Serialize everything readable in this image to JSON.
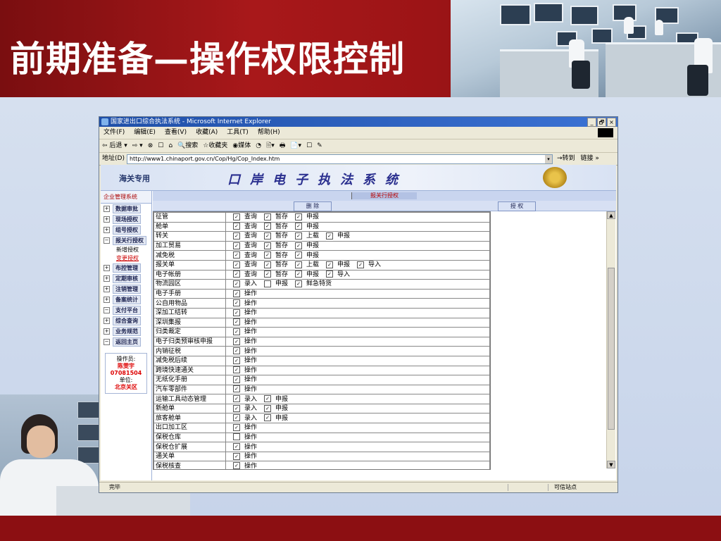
{
  "slide": {
    "title": "前期准备—操作权限控制"
  },
  "window": {
    "title": "国家进出口综合执法系统 - Microsoft Internet Explorer",
    "controls": [
      "_",
      "🗗",
      "×"
    ],
    "menu": [
      "文件(F)",
      "编辑(E)",
      "查看(V)",
      "收藏(A)",
      "工具(T)",
      "帮助(H)"
    ],
    "toolbar": [
      "⇦ 后退 ▾",
      "⇨ ▾",
      "⊗",
      "☐",
      "⌂",
      "🔍搜索",
      "☆收藏夹",
      "◉媒体",
      "◔",
      "🖹▾",
      "🖶",
      "📄▾",
      "☐",
      "✎"
    ],
    "address_label": "地址(D)",
    "address": "http://www1.chinaport.gov.cn/Cop/Hg/Cop_Index.htm",
    "go": "→转到",
    "links": "链接 »",
    "status_left": "完毕",
    "status_right": "可信站点"
  },
  "banner": {
    "tag": "海关专用",
    "system": "口岸电子执法系统"
  },
  "nav": {
    "header": "企业管理系统",
    "items": [
      {
        "pm": "+",
        "label": "数据审批"
      },
      {
        "pm": "+",
        "label": "现场授权"
      },
      {
        "pm": "+",
        "label": "组号授权"
      },
      {
        "pm": "−",
        "label": "报关行授权"
      },
      {
        "pm": "+",
        "label": "布控管理"
      },
      {
        "pm": "+",
        "label": "定期审核"
      },
      {
        "pm": "+",
        "label": "注销管理"
      },
      {
        "pm": "+",
        "label": "备案统计"
      },
      {
        "pm": "−",
        "label": "支付平台"
      },
      {
        "pm": "+",
        "label": "综合查询"
      },
      {
        "pm": "+",
        "label": "业务规范"
      },
      {
        "pm": "−",
        "label": "返回主页"
      }
    ],
    "subitems": [
      "新增授权",
      "变更授权"
    ],
    "user": {
      "label_op": "操作员:",
      "op": "陈雯宇",
      "id": "07081504",
      "label_unit": "单位:",
      "unit": "北京关区"
    }
  },
  "main": {
    "crumb": "报关行授权",
    "delete_btn": "删 除",
    "grant_btn": "授 权",
    "rows": [
      {
        "name": "征管",
        "opts": [
          {
            "c": true,
            "t": "查询"
          },
          {
            "c": true,
            "t": "暂存"
          },
          {
            "c": true,
            "t": "申报"
          }
        ]
      },
      {
        "name": "舱单",
        "opts": [
          {
            "c": true,
            "t": "查询"
          },
          {
            "c": true,
            "t": "暂存"
          },
          {
            "c": true,
            "t": "申报"
          }
        ]
      },
      {
        "name": "转关",
        "opts": [
          {
            "c": true,
            "t": "查询"
          },
          {
            "c": true,
            "t": "暂存"
          },
          {
            "c": true,
            "t": "上载"
          },
          {
            "c": true,
            "t": "申报"
          }
        ]
      },
      {
        "name": "加工贸易",
        "opts": [
          {
            "c": true,
            "t": "查询"
          },
          {
            "c": true,
            "t": "暂存"
          },
          {
            "c": true,
            "t": "申报"
          }
        ]
      },
      {
        "name": "减免税",
        "opts": [
          {
            "c": true,
            "t": "查询"
          },
          {
            "c": true,
            "t": "暂存"
          },
          {
            "c": true,
            "t": "申报"
          }
        ]
      },
      {
        "name": "报关单",
        "opts": [
          {
            "c": true,
            "t": "查询"
          },
          {
            "c": true,
            "t": "暂存"
          },
          {
            "c": true,
            "t": "上载"
          },
          {
            "c": true,
            "t": "申报"
          },
          {
            "c": true,
            "t": "导入"
          }
        ]
      },
      {
        "name": "电子帐册",
        "opts": [
          {
            "c": true,
            "t": "查询"
          },
          {
            "c": true,
            "t": "暂存"
          },
          {
            "c": true,
            "t": "申报"
          },
          {
            "c": true,
            "t": "导入"
          }
        ]
      },
      {
        "name": "物流园区",
        "opts": [
          {
            "c": true,
            "t": "录入"
          },
          {
            "c": false,
            "t": "申报"
          },
          {
            "c": true,
            "t": "鲜急特货"
          }
        ]
      },
      {
        "name": "电子手册",
        "opts": [
          {
            "c": true,
            "t": "操作"
          }
        ]
      },
      {
        "name": "公自用物品",
        "opts": [
          {
            "c": true,
            "t": "操作"
          }
        ]
      },
      {
        "name": "深加工结转",
        "opts": [
          {
            "c": true,
            "t": "操作"
          }
        ]
      },
      {
        "name": "深圳集报",
        "opts": [
          {
            "c": true,
            "t": "操作"
          }
        ]
      },
      {
        "name": "归类裁定",
        "opts": [
          {
            "c": true,
            "t": "操作"
          }
        ]
      },
      {
        "name": "电子归类预审核申报",
        "opts": [
          {
            "c": true,
            "t": "操作"
          }
        ]
      },
      {
        "name": "内销征税",
        "opts": [
          {
            "c": true,
            "t": "操作"
          }
        ]
      },
      {
        "name": "减免税后续",
        "opts": [
          {
            "c": true,
            "t": "操作"
          }
        ]
      },
      {
        "name": "跨境快速通关",
        "opts": [
          {
            "c": true,
            "t": "操作"
          }
        ]
      },
      {
        "name": "无纸化手册",
        "opts": [
          {
            "c": true,
            "t": "操作"
          }
        ]
      },
      {
        "name": "汽车零部件",
        "opts": [
          {
            "c": true,
            "t": "操作"
          }
        ]
      },
      {
        "name": "运输工具动态管理",
        "opts": [
          {
            "c": true,
            "t": "录入"
          },
          {
            "c": true,
            "t": "申报"
          }
        ]
      },
      {
        "name": "新舱单",
        "opts": [
          {
            "c": true,
            "t": "录入"
          },
          {
            "c": true,
            "t": "申报"
          }
        ]
      },
      {
        "name": "旅客舱单",
        "opts": [
          {
            "c": true,
            "t": "录入"
          },
          {
            "c": true,
            "t": "申报"
          }
        ]
      },
      {
        "name": "出口加工区",
        "opts": [
          {
            "c": true,
            "t": "操作"
          }
        ]
      },
      {
        "name": "保税仓库",
        "opts": [
          {
            "c": false,
            "t": "操作"
          }
        ]
      },
      {
        "name": "保税仓扩展",
        "opts": [
          {
            "c": true,
            "t": "操作"
          }
        ]
      },
      {
        "name": "通关单",
        "opts": [
          {
            "c": true,
            "t": "操作"
          }
        ]
      },
      {
        "name": "保税核查",
        "opts": [
          {
            "c": true,
            "t": "操作"
          }
        ]
      }
    ]
  }
}
